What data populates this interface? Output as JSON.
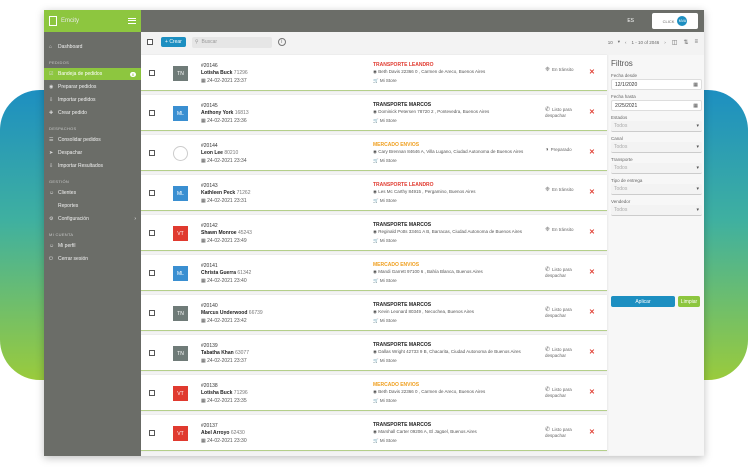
{
  "app": {
    "name": "Emcity"
  },
  "header": {
    "lang": "ES",
    "brand": "CLICK",
    "brand_circle": "MVA"
  },
  "toolbar": {
    "create_label": "Crear",
    "search_placeholder": "Buscar",
    "per_page": "10",
    "range": "1 - 10 of 2046"
  },
  "sidebar": {
    "items": [
      {
        "key": "dashboard",
        "label": "Dashboard",
        "icon": "⌂"
      }
    ],
    "sections": [
      {
        "title": "PEDIDOS",
        "items": [
          {
            "key": "bandeja",
            "label": "Bandeja de pedidos",
            "icon": "☑",
            "badge": "8",
            "active": true
          },
          {
            "key": "preparar",
            "label": "Preparar pedidos",
            "icon": "◉"
          },
          {
            "key": "importar",
            "label": "Importar pedidos",
            "icon": "⇩"
          },
          {
            "key": "crear",
            "label": "Crear pedido",
            "icon": "✚"
          }
        ]
      },
      {
        "title": "DESPACHOS",
        "items": [
          {
            "key": "consolidar",
            "label": "Consolidar pedidos",
            "icon": "☰"
          },
          {
            "key": "despachar",
            "label": "Despachar",
            "icon": "➤"
          },
          {
            "key": "importar-res",
            "label": "Importar Resultados",
            "icon": "⇩"
          }
        ]
      },
      {
        "title": "GESTIÓN",
        "items": [
          {
            "key": "clientes",
            "label": "Clientes",
            "icon": "☺"
          },
          {
            "key": "reportes",
            "label": "Reportes",
            "icon": ""
          },
          {
            "key": "configuracion",
            "label": "Configuración",
            "icon": "⚙",
            "chev": "›"
          }
        ]
      },
      {
        "title": "MI CUENTA",
        "items": [
          {
            "key": "perfil",
            "label": "Mi perfil",
            "icon": "☺"
          },
          {
            "key": "cerrar",
            "label": "Cerrar sesión",
            "icon": "⏻"
          }
        ]
      }
    ]
  },
  "orders": [
    {
      "id": "#20146",
      "name": "Lotisha Buck",
      "num": "71296",
      "date": "24-02-2021 23:37",
      "carrier": "TRANSPORTE LEANDRO",
      "carrier_color": "#e03a2f",
      "address": "Beth Davis 22366 0 , Carmen de Areco, Buenos Aires",
      "store": "Mi Store",
      "status": "En tránsito",
      "avatar": "TN",
      "avatar_color": "#6f7b78"
    },
    {
      "id": "#20145",
      "name": "Anthony York",
      "num": "16813",
      "date": "24-02-2021 23:36",
      "carrier": "TRANSPORTE MARCOS",
      "carrier_color": "#222222",
      "address": "Dominick Petersen 78720 2 , Pontevedra, Buenos Aires",
      "store": "Mi Store",
      "status": "Listo para despachar",
      "avatar": "ML",
      "avatar_color": "#3a8fd1"
    },
    {
      "id": "#20144",
      "name": "Leon Lee",
      "num": "80210",
      "date": "24-02-2021 23:34",
      "carrier": "MERCADO ENVIOS",
      "carrier_color": "#f0a020",
      "address": "Cary Brennan 84646 A, Villa Lugano, Ciudad Autonoma de Buenos Aires",
      "store": "Mi Store",
      "status": "Preparado",
      "avatar": "",
      "avatar_color": "#ffffff"
    },
    {
      "id": "#20143",
      "name": "Kathleen Peck",
      "num": "71262",
      "date": "24-02-2021 23:31",
      "carrier": "TRANSPORTE LEANDRO",
      "carrier_color": "#e03a2f",
      "address": "Les Mc Carthy 84915 , Pergamino, Buenos Aires",
      "store": "Mi Store",
      "status": "En tránsito",
      "avatar": "ML",
      "avatar_color": "#3a8fd1"
    },
    {
      "id": "#20142",
      "name": "Shawn Monroe",
      "num": "45243",
      "date": "24-02-2021 23:49",
      "carrier": "TRANSPORTE MARCOS",
      "carrier_color": "#222222",
      "address": "Reginald Potts 33461 A B, Barracas, Ciudad Autonoma de Buenos Aires",
      "store": "Mi Store",
      "status": "En tránsito",
      "avatar": "VT",
      "avatar_color": "#e03a2f"
    },
    {
      "id": "#20141",
      "name": "Christa Guerra",
      "num": "61342",
      "date": "24-02-2021 23:40",
      "carrier": "MERCADO ENVIOS",
      "carrier_color": "#f0a020",
      "address": "Mandi Garrett 97100 6 , Bahía Blanca, Buenos Aires",
      "store": "Mi Store",
      "status": "Listo para despachar",
      "avatar": "ML",
      "avatar_color": "#3a8fd1"
    },
    {
      "id": "#20140",
      "name": "Marcus Underwood",
      "num": "66739",
      "date": "24-02-2021 23:42",
      "carrier": "TRANSPORTE MARCOS",
      "carrier_color": "#222222",
      "address": "Kevin Leonard 80349 , Necochea, Buenos Aires",
      "store": "Mi Store",
      "status": "Listo para despachar",
      "avatar": "TN",
      "avatar_color": "#6f7b78"
    },
    {
      "id": "#20139",
      "name": "Tabatha Khan",
      "num": "63077",
      "date": "24-02-2021 23:37",
      "carrier": "TRANSPORTE MARCOS",
      "carrier_color": "#222222",
      "address": "Dallas Wright 42733 9 B, Chacarita, Ciudad Autonoma de Buenos Aires",
      "store": "Mi Store",
      "status": "Listo para despachar",
      "avatar": "TN",
      "avatar_color": "#6f7b78"
    },
    {
      "id": "#20138",
      "name": "Lotisha Buck",
      "num": "71296",
      "date": "24-02-2021 23:35",
      "carrier": "MERCADO ENVIOS",
      "carrier_color": "#f0a020",
      "address": "Beth Davis 22366 0 , Carmen de Areco, Buenos Aires",
      "store": "Mi Store",
      "status": "Listo para despachar",
      "avatar": "VT",
      "avatar_color": "#e03a2f"
    },
    {
      "id": "#20137",
      "name": "Abel Arroyo",
      "num": "62430",
      "date": "24-02-2021 23:30",
      "carrier": "TRANSPORTE MARCOS",
      "carrier_color": "#222222",
      "address": "Marshall Carter 09206 A, El Jagüel, Buenos Aires",
      "store": "Mi Store",
      "status": "Listo para despachar",
      "avatar": "VT",
      "avatar_color": "#e03a2f"
    }
  ],
  "filters": {
    "title": "Filtros",
    "date_from_label": "Fecha desde",
    "date_from": "12/1/2020",
    "date_to_label": "Fecha hasta",
    "date_to": "2/25/2021",
    "estados_label": "Estados",
    "estados_value": "Todos",
    "canal_label": "Canal",
    "canal_value": "Todos",
    "transporte_label": "Transporte",
    "transporte_value": "Todos",
    "tipo_label": "Tipo de entrega",
    "tipo_value": "Todos",
    "vendedor_label": "Vendedor",
    "vendedor_value": "Todos",
    "apply_label": "Aplicar",
    "clear_label": "Limpiar"
  }
}
